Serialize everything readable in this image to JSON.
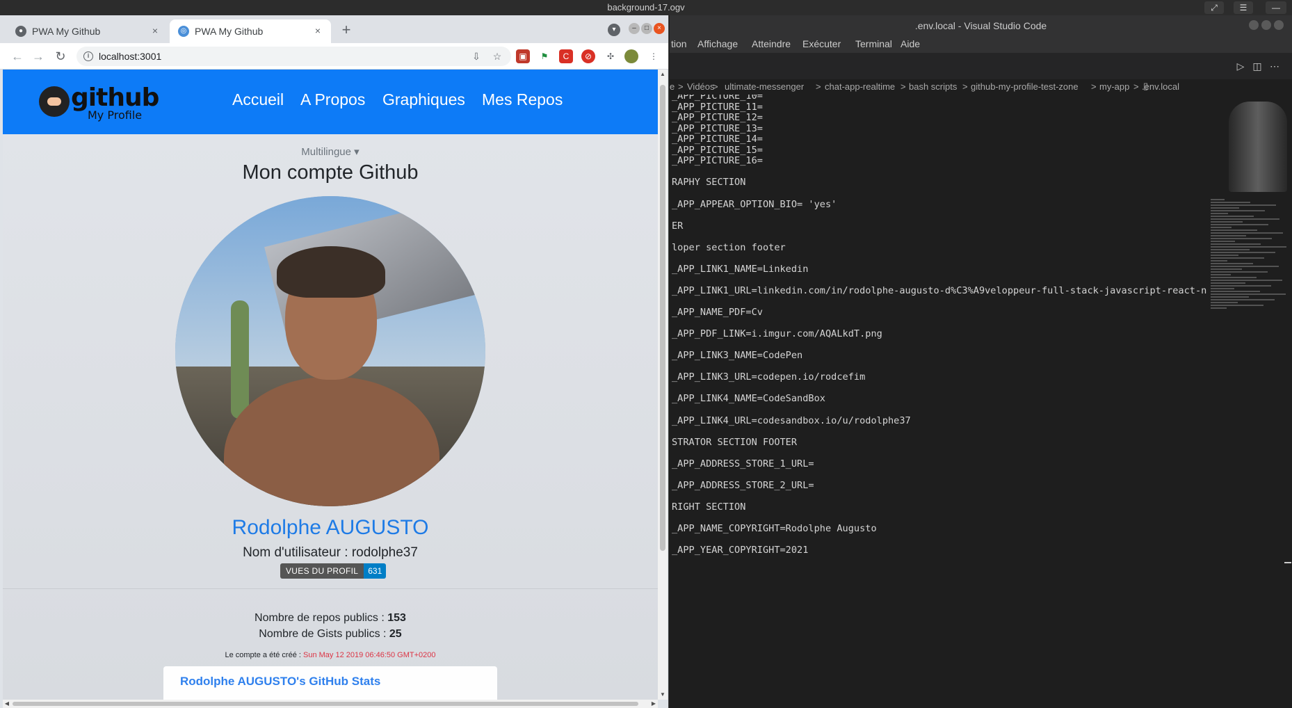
{
  "os": {
    "window_title": "background-17.ogv"
  },
  "browser": {
    "tabs": [
      {
        "title": "PWA My Github",
        "close": "×",
        "favicon": "github-favicon"
      },
      {
        "title": "PWA My Github",
        "close": "×",
        "favicon": "globe-favicon"
      }
    ],
    "new_tab": "+",
    "url": "localhost:3001"
  },
  "site": {
    "logo_main": "github",
    "logo_sub": "My Profile",
    "nav": [
      "Accueil",
      "A Propos",
      "Graphiques",
      "Mes Repos"
    ],
    "language_dropdown": "Multilingue",
    "language_caret": "▾",
    "page_title": "Mon compte Github",
    "user_full_name": "Rodolphe AUGUSTO",
    "username_line": "Nom d'utilisateur : rodolphe37",
    "views_badge": {
      "label": "VUES DU PROFIL",
      "count": "631"
    },
    "repos_label": "Nombre de repos publics : ",
    "repos_value": "153",
    "gists_label": "Nombre de Gists publics : ",
    "gists_value": "25",
    "created_label": "Le compte a été créé : ",
    "created_date": "Sun May 12 2019 06:46:50 GMT+0200",
    "stats_card_title": "Rodolphe AUGUSTO's GitHub Stats"
  },
  "vscode": {
    "title": ".env.local - Visual Studio Code",
    "menu": [
      "tion",
      "Affichage",
      "Atteindre",
      "Exécuter",
      "Terminal",
      "Aide"
    ],
    "breadcrumb": [
      "e",
      ">",
      "Vidéos",
      ">",
      "ultimate-messenger",
      ">",
      "chat-app-realtime",
      ">",
      "bash scripts",
      ">",
      "github-my-profile-test-zone",
      ">",
      "my-app",
      ">",
      ".env.local"
    ],
    "code_lines": [
      "_APP_PICTURE_10=",
      "_APP_PICTURE_11=",
      "_APP_PICTURE_12=",
      "_APP_PICTURE_13=",
      "_APP_PICTURE_14=",
      "_APP_PICTURE_15=",
      "_APP_PICTURE_16=",
      "",
      "RAPHY SECTION",
      "",
      "_APP_APPEAR_OPTION_BIO= 'yes'",
      "",
      "ER",
      "",
      "loper section footer",
      "",
      "_APP_LINK1_NAME=Linkedin",
      "",
      "_APP_LINK1_URL=linkedin.com/in/rodolphe-augusto-d%C3%A9veloppeur-full-stack-javascript-react-n",
      "",
      "_APP_NAME_PDF=Cv",
      "",
      "_APP_PDF_LINK=i.imgur.com/AQALkdT.png",
      "",
      "_APP_LINK3_NAME=CodePen",
      "",
      "_APP_LINK3_URL=codepen.io/rodcefim",
      "",
      "_APP_LINK4_NAME=CodeSandBox",
      "",
      "_APP_LINK4_URL=codesandbox.io/u/rodolphe37",
      "",
      "STRATOR SECTION FOOTER",
      "",
      "_APP_ADDRESS_STORE_1_URL=",
      "",
      "_APP_ADDRESS_STORE_2_URL=",
      "",
      "RIGHT SECTION",
      "",
      "_APP_NAME_COPYRIGHT=Rodolphe Augusto",
      "",
      "_APP_YEAR_COPYRIGHT=2021"
    ]
  }
}
